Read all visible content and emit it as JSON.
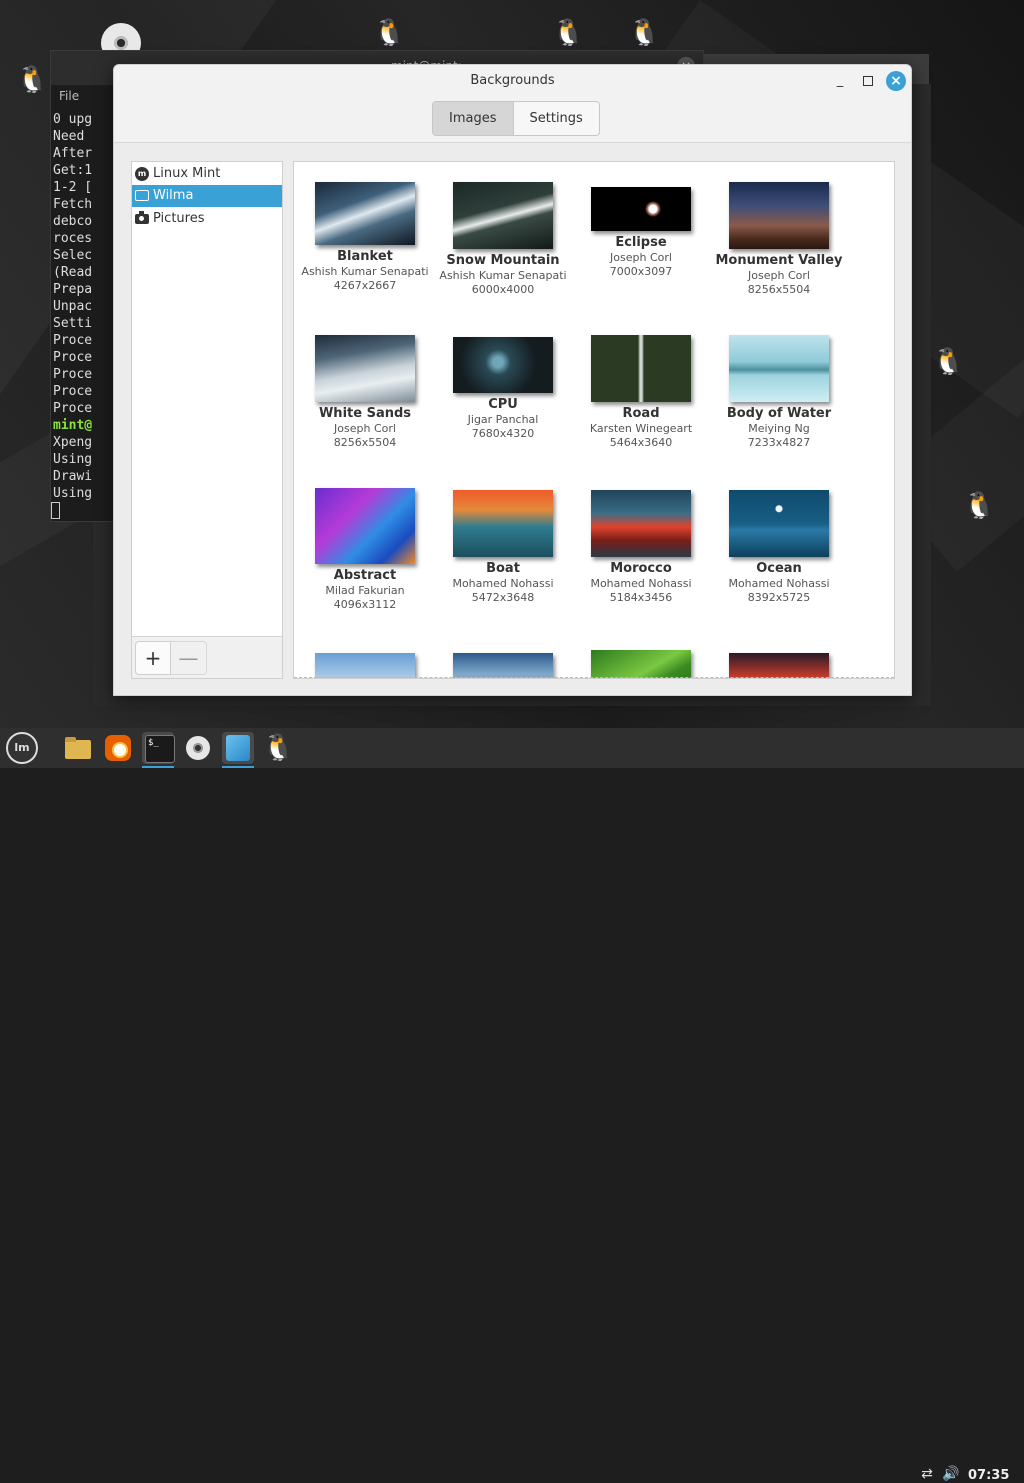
{
  "terminal": {
    "title": "mint@mint: ~",
    "menu": "File",
    "lines": [
      "0 upg",
      "Need ",
      "After",
      "Get:1",
      "1-2 [",
      "Fetch",
      "debco",
      "roces",
      "Selec",
      "(Read",
      "Prepa",
      "Unpac",
      "Setti",
      "Proce",
      "Proce",
      "Proce",
      "Proce",
      "Proce",
      "mint@",
      "Xpeng",
      "Using",
      "Drawi",
      "Using"
    ]
  },
  "window": {
    "title": "Backgrounds",
    "minimize_label": "_",
    "close_label": "×"
  },
  "tabs": [
    {
      "label": "Images",
      "active": true
    },
    {
      "label": "Settings",
      "active": false
    }
  ],
  "sidebar": {
    "items": [
      {
        "label": "Linux Mint",
        "icon": "linux-mint-icon",
        "selected": false
      },
      {
        "label": "Wilma",
        "icon": "monitor-icon",
        "selected": true
      },
      {
        "label": "Pictures",
        "icon": "camera-icon",
        "selected": false
      }
    ],
    "add_label": "+",
    "remove_label": "—",
    "selection_color": "#3aa1d6"
  },
  "gallery": {
    "items": [
      {
        "name": "Blanket",
        "author": "Ashish Kumar Senapati",
        "size": "4267x2667"
      },
      {
        "name": "Snow Mountain",
        "author": "Ashish Kumar Senapati",
        "size": "6000x4000"
      },
      {
        "name": "Eclipse",
        "author": "Joseph Corl",
        "size": "7000x3097"
      },
      {
        "name": "Monument Valley",
        "author": "Joseph Corl",
        "size": "8256x5504"
      },
      {
        "name": "White Sands",
        "author": "Joseph Corl",
        "size": "8256x5504"
      },
      {
        "name": "CPU",
        "author": "Jigar Panchal",
        "size": "7680x4320"
      },
      {
        "name": "Road",
        "author": "Karsten Winegeart",
        "size": "5464x3640"
      },
      {
        "name": "Body of Water",
        "author": "Meiying Ng",
        "size": "7233x4827"
      },
      {
        "name": "Abstract",
        "author": "Milad Fakurian",
        "size": "4096x3112"
      },
      {
        "name": "Boat",
        "author": "Mohamed Nohassi",
        "size": "5472x3648"
      },
      {
        "name": "Morocco",
        "author": "Mohamed Nohassi",
        "size": "5184x3456"
      },
      {
        "name": "Ocean",
        "author": "Mohamed Nohassi",
        "size": "8392x5725"
      }
    ]
  },
  "taskbar": {
    "menu_label": "lm",
    "clock": "07:35",
    "accent": "#3aa1d6"
  }
}
